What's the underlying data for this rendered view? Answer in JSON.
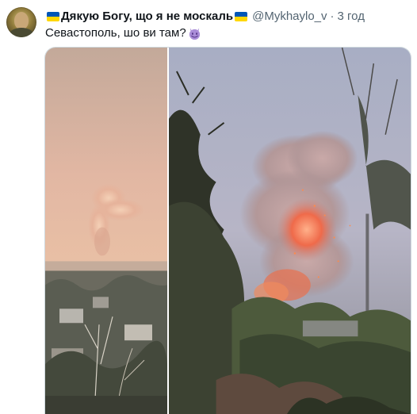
{
  "tweet": {
    "display_name": "Дякую Богу, що я не москаль",
    "handle": "@Mykhaylo_v",
    "separator": "·",
    "time": "3 год",
    "text": "Севастополь, шо ви там?",
    "emoji": "smiling-face-with-horns-icon"
  },
  "colors": {
    "flag_blue": "#0057b7",
    "flag_yellow": "#ffd700",
    "handle_gray": "#536471",
    "text_dark": "#0f1419"
  }
}
